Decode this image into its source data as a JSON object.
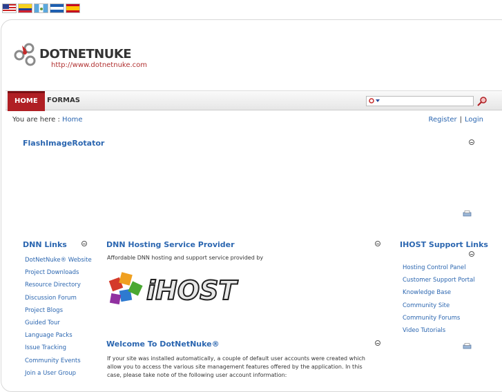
{
  "language_flags": [
    "us-flag-icon",
    "colombia-flag-icon",
    "guatemala-flag-icon",
    "nicaragua-flag-icon",
    "spain-flag-icon"
  ],
  "logo": {
    "text": "DOTNETNUKE",
    "url": "http://www.dotnetnuke.com"
  },
  "nav": {
    "home": "HOME",
    "formas": "FORMAS"
  },
  "search": {
    "value": "",
    "placeholder": ""
  },
  "breadcrumb": {
    "label": "You are here :",
    "current": "Home"
  },
  "auth": {
    "register": "Register",
    "separator": "|",
    "login": "Login"
  },
  "rotator": {
    "title": "FlashImageRotator"
  },
  "dnn_links": {
    "title": "DNN Links",
    "items": [
      "DotNetNuke® Website",
      "Project Downloads",
      "Resource Directory",
      "Discussion Forum",
      "Project Blogs",
      "Guided Tour",
      "Language Packs",
      "Issue Tracking",
      "Community Events",
      "Join a User Group"
    ]
  },
  "hosting": {
    "title": "DNN Hosting Service Provider",
    "text": "Affordable DNN hosting and support service provided by",
    "brand": "iHOST"
  },
  "welcome": {
    "title": "Welcome To DotNetNuke®",
    "text": "If your site was installed automatically, a couple of default user accounts were created which allow you to access the various site management features offered by the application. In this case, please take note of the following user account information:"
  },
  "ihost_links": {
    "title": "IHOST Support Links",
    "items": [
      "Hosting Control Panel",
      "Customer Support Portal",
      "Knowledge Base",
      "Community Site",
      "Community Forums",
      "Video Tutorials"
    ]
  },
  "colors": {
    "accent": "#b01f24",
    "link": "#2b66b0"
  }
}
